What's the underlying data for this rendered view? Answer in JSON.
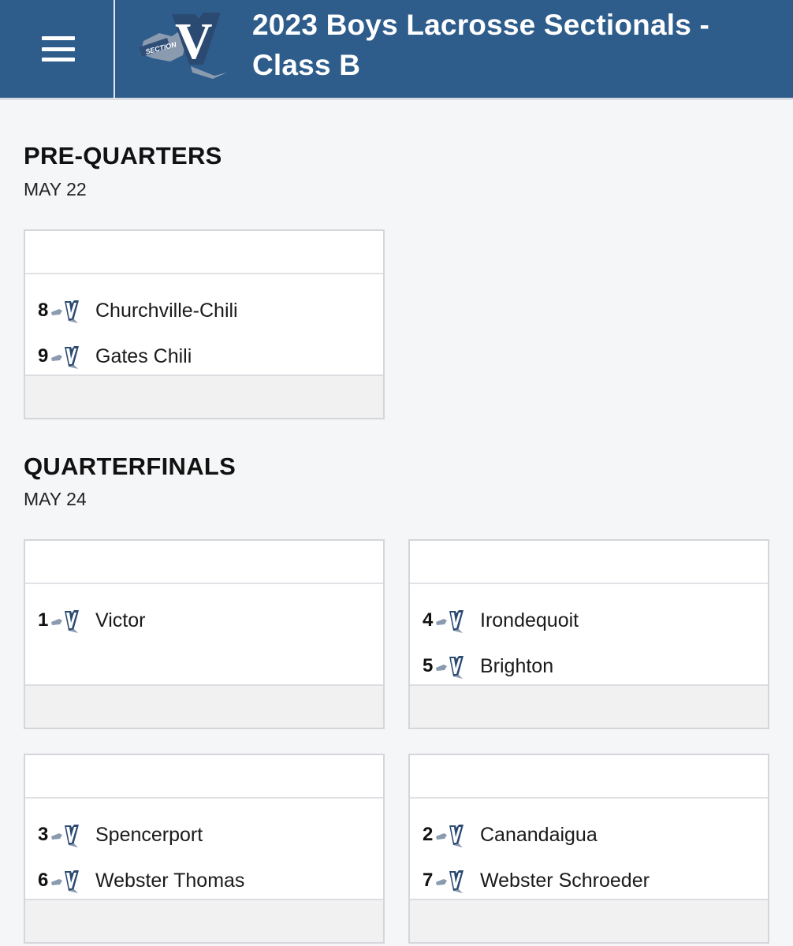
{
  "header": {
    "title_line1": "2023 Boys Lacrosse Sectionals -",
    "title_line2": "Class B",
    "logo": {
      "letter": "V",
      "text": "SECTION",
      "icon": "section-v-logo"
    },
    "menu_icon": "hamburger-menu-icon"
  },
  "colors": {
    "header": "#2e5d8c",
    "background": "#f5f6f8",
    "card_footer": "#f1f1f2"
  },
  "rounds": [
    {
      "name": "PRE-QUARTERS",
      "date": "MAY 22",
      "games": [
        {
          "teams": [
            {
              "seed": "8",
              "name": "Churchville-Chili"
            },
            {
              "seed": "9",
              "name": "Gates Chili"
            }
          ]
        }
      ]
    },
    {
      "name": "QUARTERFINALS",
      "date": "MAY 24",
      "games": [
        {
          "teams": [
            {
              "seed": "1",
              "name": "Victor"
            }
          ]
        },
        {
          "teams": [
            {
              "seed": "4",
              "name": "Irondequoit"
            },
            {
              "seed": "5",
              "name": "Brighton"
            }
          ]
        },
        {
          "teams": [
            {
              "seed": "3",
              "name": "Spencerport"
            },
            {
              "seed": "6",
              "name": "Webster Thomas"
            }
          ]
        },
        {
          "teams": [
            {
              "seed": "2",
              "name": "Canandaigua"
            },
            {
              "seed": "7",
              "name": "Webster Schroeder"
            }
          ]
        }
      ]
    }
  ]
}
